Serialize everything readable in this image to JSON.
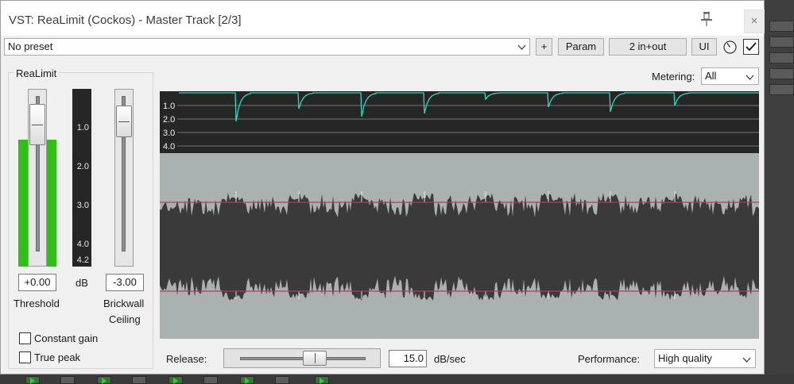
{
  "window": {
    "title": "VST: ReaLimit (Cockos) - Master Track [2/3]",
    "close_glyph": "×",
    "pin_icon": "pin-icon"
  },
  "toolbar": {
    "preset_value": "No preset",
    "add_label": "+",
    "param_label": "Param",
    "routing_label": "2 in+out",
    "ui_label": "UI",
    "bypass_checked": true
  },
  "group": {
    "title": "ReaLimit",
    "db_ticks": [
      "1.0",
      "2.0",
      "3.0",
      "4.0",
      "4.2"
    ],
    "threshold_value": "+0.00",
    "threshold_label": "Threshold",
    "db_unit": "dB",
    "ceiling_value": "-3.00",
    "ceiling_label_1": "Brickwall",
    "ceiling_label_2": "Ceiling",
    "constant_gain_label": "Constant gain",
    "true_peak_label": "True peak",
    "constant_gain_checked": false,
    "true_peak_checked": false
  },
  "metering": {
    "label": "Metering:",
    "value": "All",
    "gr_ticks": [
      "1.0",
      "2.0",
      "3.0",
      "4.0"
    ]
  },
  "release": {
    "label": "Release:",
    "value": "15.0",
    "unit": "dB/sec"
  },
  "performance": {
    "label": "Performance:",
    "value": "High quality"
  },
  "colors": {
    "gr_line": "#33d6c0",
    "ceiling_line": "#c8325a",
    "meter_green": "#2fbf17",
    "waveform": "#3a3a3a",
    "wave_bg": "#a9b1b1"
  }
}
